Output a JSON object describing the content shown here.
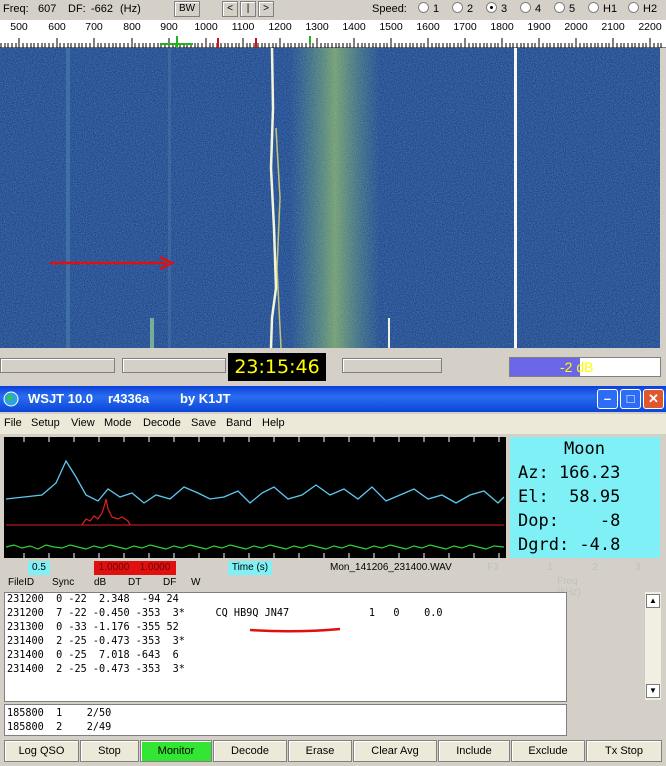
{
  "spectran": {
    "freq_label": "Freq:",
    "freq_value": "607",
    "df_label": "DF:",
    "df_value": "-662",
    "df_unit": "(Hz)",
    "bw_label": "BW",
    "nav_prev": "<",
    "nav_mid": "|",
    "nav_next": ">",
    "speed_label": "Speed:",
    "speed_options": [
      "1",
      "2",
      "3",
      "4",
      "5",
      "H1",
      "H2"
    ],
    "speed_selected": "3",
    "ruler_ticks": [
      "500",
      "600",
      "700",
      "800",
      "900",
      "1000",
      "1100",
      "1200",
      "1300",
      "1400",
      "1500",
      "1600",
      "1700",
      "1800",
      "1900",
      "2000",
      "2100",
      "2200"
    ],
    "clock": "23:15:46",
    "db_value": "-2",
    "db_unit": "dB"
  },
  "wsjt": {
    "title": "WSJT 10.0",
    "revision": "r4336a",
    "author": "by K1JT",
    "menu": [
      "File",
      "Setup",
      "View",
      "Mode",
      "Decode",
      "Save",
      "Band",
      "Help"
    ],
    "moon": {
      "title": "Moon",
      "az": "Az: 166.23",
      "el": "El:  58.95",
      "dop": "Dop:    -8",
      "dgrd": "Dgrd: -4.8"
    },
    "status": {
      "a": "0.5",
      "b": "1.0000",
      "c": "1.0000",
      "time_label": "Time (s)",
      "file": "Mon_141206_231400.WAV",
      "f3": "F3",
      "n1": "1",
      "n2": "2",
      "n3": "3",
      "freq_label": "Freq (kHz)"
    },
    "columns": [
      "FileID",
      "Sync",
      "dB",
      "DT",
      "DF",
      "W"
    ],
    "decodes": [
      "231200  0 -22  2.348  -94 24",
      "231200  7 -22 -0.450 -353  3*     CQ HB9Q JN47             1   0    0.0",
      "231300  0 -33 -1.176 -355 52",
      "231400  2 -25 -0.473 -353  3*",
      "231400  0 -25  7.018 -643  6",
      "231400  2 -25 -0.473 -353  3*"
    ],
    "averages": [
      "185800  1    2/50",
      "185800  2    2/49"
    ],
    "buttons": [
      "Log QSO",
      "Stop",
      "Monitor",
      "Decode",
      "Erase",
      "Clear Avg",
      "Include",
      "Exclude",
      "Tx Stop"
    ]
  },
  "colors": {
    "waterfall_bg": "#1b2d78",
    "moon_bg": "#7ff0f5",
    "monitor_green": "#33e633",
    "clock_text": "#ffff00",
    "annotation_red": "#e01010"
  }
}
